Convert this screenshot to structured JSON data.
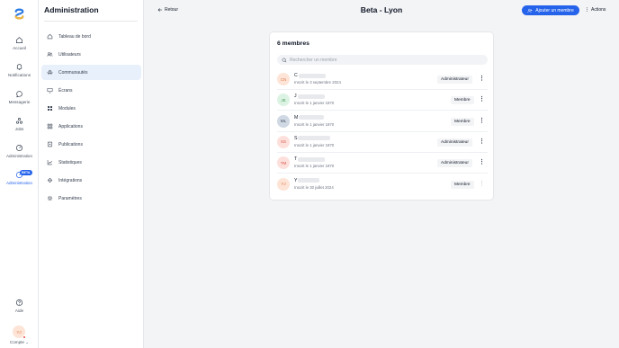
{
  "rail": {
    "items": [
      {
        "label": "Accueil",
        "icon": "home-icon"
      },
      {
        "label": "Notifications",
        "icon": "bell-icon"
      },
      {
        "label": "Messagerie",
        "icon": "chat-icon"
      },
      {
        "label": "Jobs",
        "icon": "jobs-icon"
      },
      {
        "label": "Administration",
        "icon": "speedometer-icon"
      },
      {
        "label": "Administration",
        "icon": "admin-icon",
        "badge": "BETA"
      }
    ],
    "help_label": "Aide",
    "user_initials": "YJ",
    "account_label": "Compte ⌄"
  },
  "sidebar": {
    "title": "Administration",
    "items": [
      {
        "label": "Tableau de bord",
        "icon": "home-icon"
      },
      {
        "label": "Utilisateurs",
        "icon": "users-icon"
      },
      {
        "label": "Communautés",
        "icon": "community-icon",
        "active": true
      },
      {
        "label": "Écrans",
        "icon": "monitor-icon"
      },
      {
        "label": "Modules",
        "icon": "modules-icon"
      },
      {
        "label": "Applications",
        "icon": "apps-icon"
      },
      {
        "label": "Publications",
        "icon": "publication-icon"
      },
      {
        "label": "Statistiques",
        "icon": "stats-icon"
      },
      {
        "label": "Intégrations",
        "icon": "integration-icon"
      },
      {
        "label": "Paramètres",
        "icon": "gear-icon"
      }
    ]
  },
  "header": {
    "back_label": "Retour",
    "title": "Beta - Lyon",
    "add_member_label": "Ajouter un membre",
    "actions_label": "Actions"
  },
  "members": {
    "count_label": "6 membres",
    "search_placeholder": "Rechercher un membre",
    "list": [
      {
        "initials": "CN",
        "first_letter": "C",
        "joined": "Inscrit le 3 septembre 2024",
        "role": "Administrateur",
        "avatar_bg": "#fde4d6",
        "avatar_fg": "#e07a4b"
      },
      {
        "initials": "JE",
        "first_letter": "J",
        "joined": "Inscrit le 1 janvier 1970",
        "role": "Membre",
        "avatar_bg": "#dcf3e3",
        "avatar_fg": "#3f9a5a"
      },
      {
        "initials": "ML",
        "first_letter": "M",
        "joined": "Inscrit le 1 janvier 1970",
        "role": "Membre",
        "avatar_bg": "#cfd8e3",
        "avatar_fg": "#3f4a5a"
      },
      {
        "initials": "SS",
        "first_letter": "S",
        "joined": "Inscrit le 1 janvier 1970",
        "role": "Administrateur",
        "avatar_bg": "#fde0dc",
        "avatar_fg": "#d9564b"
      },
      {
        "initials": "TM",
        "first_letter": "T",
        "joined": "Inscrit le 1 janvier 1970",
        "role": "Administrateur",
        "avatar_bg": "#fde0dc",
        "avatar_fg": "#d9564b"
      },
      {
        "initials": "YJ",
        "first_letter": "Y",
        "joined": "Inscrit le 30 juillet 2024",
        "role": "Membre",
        "avatar_bg": "#fde4d6",
        "avatar_fg": "#e07a4b",
        "menu_disabled": true
      }
    ]
  },
  "colors": {
    "accent": "#2563eb",
    "active_nav_bg": "#e8f0fb"
  }
}
